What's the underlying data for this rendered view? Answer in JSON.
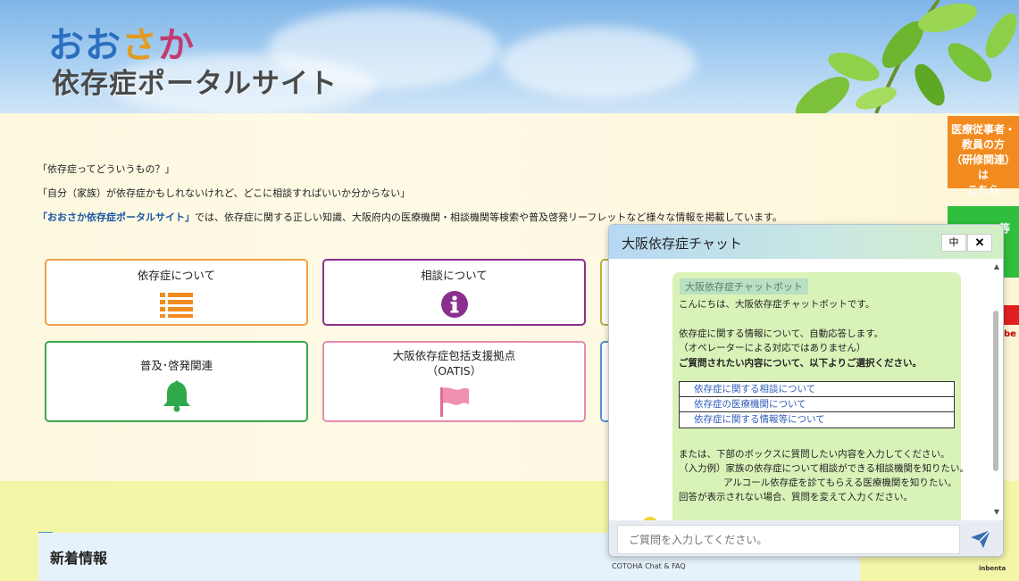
{
  "header": {
    "logo_chars": [
      "おお",
      "さ",
      "か"
    ],
    "logo_subtitle": "依存症ポータルサイト"
  },
  "intro": {
    "line1": "「依存症ってどういうもの？」",
    "line2": "「自分（家族）が依存症かもしれないけれど、どこに相談すればいいか分からない」",
    "line3_link": "「おおさか依存症ポータルサイト」",
    "line3_rest": "では、依存症に関する正しい知識、大阪府内の医療機関・相談機関等検索や普及啓発リーフレットなど様々な情報を掲載しています。"
  },
  "cards": [
    {
      "title": "依存症について",
      "icon": "list-icon",
      "color": "#f0a04a"
    },
    {
      "title": "相談について",
      "icon": "info-icon",
      "color": "#8b2f8f"
    },
    {
      "title": "普及･啓発関連",
      "icon": "bell-icon",
      "color": "#3aa84a"
    },
    {
      "title": "大阪依存症包括支援拠点\n（OATIS）",
      "title_line1": "大阪依存症包括支援拠点",
      "title_line2": "（OATIS）",
      "icon": "flag-icon",
      "color": "#e88bb0"
    }
  ],
  "news": {
    "title": "新着情報"
  },
  "side_tabs": {
    "orange": [
      "医療従事者・",
      "教員の方",
      "（研修関連）は",
      "こちら"
    ],
    "green_partial": "等",
    "red_label": "be"
  },
  "chat": {
    "title": "大阪依存症チャット",
    "size_button": "中",
    "close_button": "✕",
    "bot_name": "大阪依存症チャットボット",
    "greeting": "こんにちは、大阪依存症チャットボットです。",
    "info1": "依存症に関する情報について、自動応答します。",
    "info2": "（オペレーターによる対応ではありません）",
    "prompt": "ご質問されたい内容について、以下よりご選択ください。",
    "options": [
      "依存症に関する相談について",
      "依存症の医療機関について",
      "依存症に関する情報等について"
    ],
    "alt1": "または、下部のボックスに質問したい内容を入力してください。",
    "example1": "（入力例）家族の依存症について相談ができる相談機関を知りたい。",
    "example2": "アルコール依存症を診てもらえる医療機関を知りたい。",
    "alt2": "回答が表示されない場合、質問を変えて入力ください。",
    "input_placeholder": "ご質問を入力してください。",
    "footer_left": "COTOHA Chat & FAQ",
    "footer_right": "inbenta"
  },
  "colors": {
    "header_sky": "#8fc0ec",
    "orange_tab": "#f28b1f",
    "green_tab": "#2fbf3d",
    "link_blue": "#1b57a5"
  }
}
